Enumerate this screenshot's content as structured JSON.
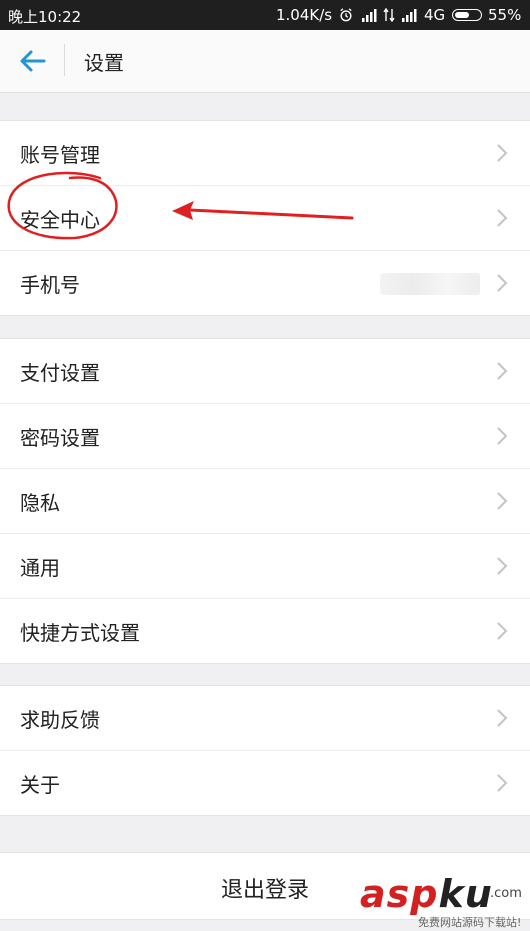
{
  "status_bar": {
    "time": "晚上10:22",
    "speed": "1.04K/s",
    "network": "4G",
    "battery": "55%"
  },
  "header": {
    "title": "设置",
    "back_icon": "arrow-left-icon",
    "accent_color": "#2196d3"
  },
  "groups": [
    {
      "items": [
        {
          "label": "账号管理"
        },
        {
          "label": "安全中心"
        },
        {
          "label": "手机号"
        }
      ]
    },
    {
      "items": [
        {
          "label": "支付设置"
        },
        {
          "label": "密码设置"
        },
        {
          "label": "隐私"
        },
        {
          "label": "通用"
        },
        {
          "label": "快捷方式设置"
        }
      ]
    },
    {
      "items": [
        {
          "label": "求助反馈"
        },
        {
          "label": "关于"
        }
      ]
    }
  ],
  "logout_label": "退出登录",
  "annotation_color": "#e02020",
  "watermark": {
    "main_asp": "asp",
    "main_ku": "ku",
    "com": ".com",
    "sub": "免费网站源码下载站!"
  }
}
